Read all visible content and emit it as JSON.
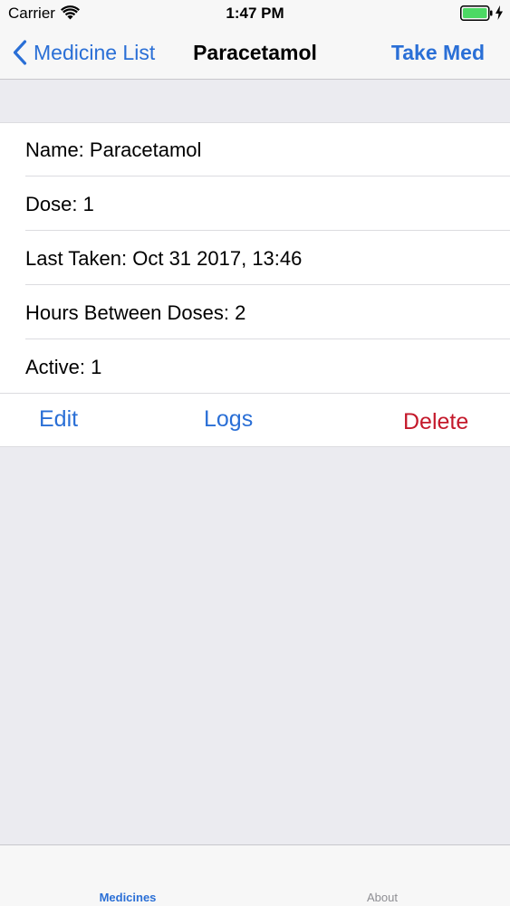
{
  "status_bar": {
    "carrier": "Carrier",
    "time": "1:47 PM",
    "wifi_icon": "wifi-icon",
    "battery_icon": "battery-icon",
    "charging_icon": "bolt-icon",
    "battery_color": "#4cd964"
  },
  "nav_bar": {
    "back_label": "Medicine List",
    "back_icon": "chevron-left-icon",
    "title": "Paracetamol",
    "action_label": "Take Med"
  },
  "details": {
    "rows": [
      "Name: Paracetamol",
      "Dose: 1",
      "Last Taken: Oct 31 2017, 13:46",
      "Hours Between Doses: 2",
      "Active: 1"
    ]
  },
  "actions": {
    "edit_label": "Edit",
    "logs_label": "Logs",
    "delete_label": "Delete"
  },
  "tab_bar": {
    "items": [
      {
        "label": "Medicines",
        "selected": true
      },
      {
        "label": "About",
        "selected": false
      }
    ]
  },
  "colors": {
    "accent": "#2a6fd6",
    "destructive": "#c4192b",
    "background": "#ebebf0",
    "bar_background": "#f7f7f7"
  }
}
